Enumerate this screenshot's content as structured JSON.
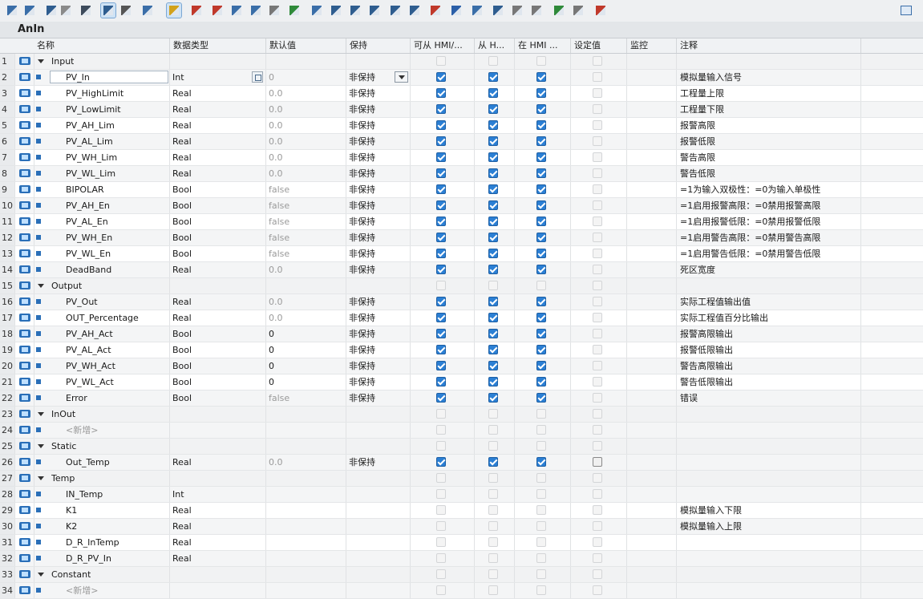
{
  "toolbar": {
    "buttons": [
      "insert-row-icon",
      "insert-row-below-icon",
      "insert-network-icon",
      "delete-icon",
      "list-view-icon",
      "detail-view-icon",
      "snapshot-icon",
      "download-icon",
      "star-icon",
      "add-breakpoint-icon",
      "remove-breakpoint-icon",
      "monitor-icon",
      "monitor-all-icon",
      "list-icon",
      "download-arrow-icon",
      "step-back-icon",
      "indent-icon",
      "outdent-icon",
      "expand-icon",
      "collapse-icon",
      "network-icon",
      "jump-icon",
      "load-start-icon",
      "reset-icon",
      "refresh-icon",
      "copy-icon",
      "glasses-icon",
      "play-icon",
      "paste-icon",
      "db-icon"
    ],
    "right_icon": "window-icon"
  },
  "block_title": "AnIn",
  "columns": [
    "名称",
    "数据类型",
    "默认值",
    "保持",
    "可从 HMI/...",
    "从 H...",
    "在 HMI ...",
    "设定值",
    "监控",
    "注释"
  ],
  "rows": [
    {
      "n": "1",
      "type": "sec",
      "name": "Input",
      "dtype": "",
      "def": "",
      "keep": "",
      "c1": "dis",
      "c2": "dis",
      "c3": "dis",
      "c4": "dis",
      "comment": ""
    },
    {
      "n": "2",
      "type": "var",
      "name": "PV_In",
      "dtype": "Int",
      "def": "0",
      "keep": "非保持",
      "c1": "on",
      "c2": "on",
      "c3": "on",
      "c4": "dis",
      "comment": "模拟量输入信号",
      "editing": true
    },
    {
      "n": "3",
      "type": "var",
      "name": "PV_HighLimit",
      "dtype": "Real",
      "def": "0.0",
      "keep": "非保持",
      "c1": "on",
      "c2": "on",
      "c3": "on",
      "c4": "dis",
      "comment": "工程量上限"
    },
    {
      "n": "4",
      "type": "var",
      "name": "PV_LowLimit",
      "dtype": "Real",
      "def": "0.0",
      "keep": "非保持",
      "c1": "on",
      "c2": "on",
      "c3": "on",
      "c4": "dis",
      "comment": "工程量下限"
    },
    {
      "n": "5",
      "type": "var",
      "name": "PV_AH_Lim",
      "dtype": "Real",
      "def": "0.0",
      "keep": "非保持",
      "c1": "on",
      "c2": "on",
      "c3": "on",
      "c4": "dis",
      "comment": "报警高限"
    },
    {
      "n": "6",
      "type": "var",
      "name": "PV_AL_Lim",
      "dtype": "Real",
      "def": "0.0",
      "keep": "非保持",
      "c1": "on",
      "c2": "on",
      "c3": "on",
      "c4": "dis",
      "comment": "报警低限"
    },
    {
      "n": "7",
      "type": "var",
      "name": "PV_WH_Lim",
      "dtype": "Real",
      "def": "0.0",
      "keep": "非保持",
      "c1": "on",
      "c2": "on",
      "c3": "on",
      "c4": "dis",
      "comment": "警告高限"
    },
    {
      "n": "8",
      "type": "var",
      "name": "PV_WL_Lim",
      "dtype": "Real",
      "def": "0.0",
      "keep": "非保持",
      "c1": "on",
      "c2": "on",
      "c3": "on",
      "c4": "dis",
      "comment": "警告低限"
    },
    {
      "n": "9",
      "type": "var",
      "name": "BIPOLAR",
      "dtype": "Bool",
      "def": "false",
      "keep": "非保持",
      "c1": "on",
      "c2": "on",
      "c3": "on",
      "c4": "dis",
      "comment": "=1为输入双极性：=0为输入单极性"
    },
    {
      "n": "10",
      "type": "var",
      "name": "PV_AH_En",
      "dtype": "Bool",
      "def": "false",
      "keep": "非保持",
      "c1": "on",
      "c2": "on",
      "c3": "on",
      "c4": "dis",
      "comment": "=1启用报警高限：=0禁用报警高限"
    },
    {
      "n": "11",
      "type": "var",
      "name": "PV_AL_En",
      "dtype": "Bool",
      "def": "false",
      "keep": "非保持",
      "c1": "on",
      "c2": "on",
      "c3": "on",
      "c4": "dis",
      "comment": "=1启用报警低限：=0禁用报警低限"
    },
    {
      "n": "12",
      "type": "var",
      "name": "PV_WH_En",
      "dtype": "Bool",
      "def": "false",
      "keep": "非保持",
      "c1": "on",
      "c2": "on",
      "c3": "on",
      "c4": "dis",
      "comment": "=1启用警告高限：=0禁用警告高限"
    },
    {
      "n": "13",
      "type": "var",
      "name": "PV_WL_En",
      "dtype": "Bool",
      "def": "false",
      "keep": "非保持",
      "c1": "on",
      "c2": "on",
      "c3": "on",
      "c4": "dis",
      "comment": "=1启用警告低限：=0禁用警告低限"
    },
    {
      "n": "14",
      "type": "var",
      "name": "DeadBand",
      "dtype": "Real",
      "def": "0.0",
      "keep": "非保持",
      "c1": "on",
      "c2": "on",
      "c3": "on",
      "c4": "dis",
      "comment": "死区宽度"
    },
    {
      "n": "15",
      "type": "sec",
      "name": "Output",
      "dtype": "",
      "def": "",
      "keep": "",
      "c1": "dis",
      "c2": "dis",
      "c3": "dis",
      "c4": "dis",
      "comment": ""
    },
    {
      "n": "16",
      "type": "var",
      "name": "PV_Out",
      "dtype": "Real",
      "def": "0.0",
      "keep": "非保持",
      "c1": "on",
      "c2": "on",
      "c3": "on",
      "c4": "dis",
      "comment": "实际工程值输出值"
    },
    {
      "n": "17",
      "type": "var",
      "name": "OUT_Percentage",
      "dtype": "Real",
      "def": "0.0",
      "keep": "非保持",
      "c1": "on",
      "c2": "on",
      "c3": "on",
      "c4": "dis",
      "comment": "实际工程值百分比输出"
    },
    {
      "n": "18",
      "type": "var",
      "name": "PV_AH_Act",
      "dtype": "Bool",
      "def": "0",
      "keep": "非保持",
      "c1": "on",
      "c2": "on",
      "c3": "on",
      "c4": "dis",
      "comment": "报警高限输出",
      "defdark": true
    },
    {
      "n": "19",
      "type": "var",
      "name": "PV_AL_Act",
      "dtype": "Bool",
      "def": "0",
      "keep": "非保持",
      "c1": "on",
      "c2": "on",
      "c3": "on",
      "c4": "dis",
      "comment": "报警低限输出",
      "defdark": true
    },
    {
      "n": "20",
      "type": "var",
      "name": "PV_WH_Act",
      "dtype": "Bool",
      "def": "0",
      "keep": "非保持",
      "c1": "on",
      "c2": "on",
      "c3": "on",
      "c4": "dis",
      "comment": "警告高限输出",
      "defdark": true
    },
    {
      "n": "21",
      "type": "var",
      "name": "PV_WL_Act",
      "dtype": "Bool",
      "def": "0",
      "keep": "非保持",
      "c1": "on",
      "c2": "on",
      "c3": "on",
      "c4": "dis",
      "comment": "警告低限输出",
      "defdark": true
    },
    {
      "n": "22",
      "type": "var",
      "name": "Error",
      "dtype": "Bool",
      "def": "false",
      "keep": "非保持",
      "c1": "on",
      "c2": "on",
      "c3": "on",
      "c4": "dis",
      "comment": "错误"
    },
    {
      "n": "23",
      "type": "sec",
      "name": "InOut",
      "dtype": "",
      "def": "",
      "keep": "",
      "c1": "dis",
      "c2": "dis",
      "c3": "dis",
      "c4": "dis",
      "comment": ""
    },
    {
      "n": "24",
      "type": "add",
      "name": "<新增>",
      "dtype": "",
      "def": "",
      "keep": "",
      "c1": "dis",
      "c2": "dis",
      "c3": "dis",
      "c4": "dis",
      "comment": ""
    },
    {
      "n": "25",
      "type": "sec",
      "name": "Static",
      "dtype": "",
      "def": "",
      "keep": "",
      "c1": "dis",
      "c2": "dis",
      "c3": "dis",
      "c4": "dis",
      "comment": ""
    },
    {
      "n": "26",
      "type": "var",
      "name": "Out_Temp",
      "dtype": "Real",
      "def": "0.0",
      "keep": "非保持",
      "c1": "on",
      "c2": "on",
      "c3": "on",
      "c4": "dark",
      "comment": ""
    },
    {
      "n": "27",
      "type": "sec",
      "name": "Temp",
      "dtype": "",
      "def": "",
      "keep": "",
      "c1": "dis",
      "c2": "dis",
      "c3": "dis",
      "c4": "dis",
      "comment": ""
    },
    {
      "n": "28",
      "type": "var",
      "name": "IN_Temp",
      "dtype": "Int",
      "def": "",
      "keep": "",
      "c1": "dis",
      "c2": "dis",
      "c3": "dis",
      "c4": "dis",
      "comment": ""
    },
    {
      "n": "29",
      "type": "var",
      "name": "K1",
      "dtype": "Real",
      "def": "",
      "keep": "",
      "c1": "dis",
      "c2": "dis",
      "c3": "dis",
      "c4": "dis",
      "comment": "模拟量输入下限"
    },
    {
      "n": "30",
      "type": "var",
      "name": "K2",
      "dtype": "Real",
      "def": "",
      "keep": "",
      "c1": "dis",
      "c2": "dis",
      "c3": "dis",
      "c4": "dis",
      "comment": "模拟量输入上限"
    },
    {
      "n": "31",
      "type": "var",
      "name": "D_R_InTemp",
      "dtype": "Real",
      "def": "",
      "keep": "",
      "c1": "dis",
      "c2": "dis",
      "c3": "dis",
      "c4": "dis",
      "comment": ""
    },
    {
      "n": "32",
      "type": "var",
      "name": "D_R_PV_In",
      "dtype": "Real",
      "def": "",
      "keep": "",
      "c1": "dis",
      "c2": "dis",
      "c3": "dis",
      "c4": "dis",
      "comment": ""
    },
    {
      "n": "33",
      "type": "sec",
      "name": "Constant",
      "dtype": "",
      "def": "",
      "keep": "",
      "c1": "dis",
      "c2": "dis",
      "c3": "dis",
      "c4": "dis",
      "comment": ""
    },
    {
      "n": "34",
      "type": "add",
      "name": "<新增>",
      "dtype": "",
      "def": "",
      "keep": "",
      "c1": "dis",
      "c2": "dis",
      "c3": "dis",
      "c4": "dis",
      "comment": ""
    }
  ],
  "colors": {
    "accent": "#2b7fd4",
    "header_bg": "#f0f2f4",
    "toolbar_bg": "#eef0f2"
  }
}
